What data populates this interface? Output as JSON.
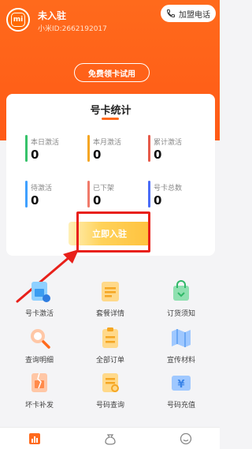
{
  "header": {
    "user_name": "未入驻",
    "user_id": "小米ID:2662192017",
    "avatar_icon": "mi-logo-icon",
    "hotline_label": "加盟电话",
    "trial_button": "免费领卡试用"
  },
  "stats_card": {
    "title": "号卡统计",
    "items": [
      {
        "label": "本日激活",
        "value": "0",
        "color": "#36c26a"
      },
      {
        "label": "本月激活",
        "value": "0",
        "color": "#f5a623"
      },
      {
        "label": "累计激活",
        "value": "0",
        "color": "#e65a4a"
      },
      {
        "label": "待激活",
        "value": "0",
        "color": "#3fa0ff"
      },
      {
        "label": "已下架",
        "value": "0",
        "color": "#f07a6a"
      },
      {
        "label": "号卡总数",
        "value": "0",
        "color": "#4a6cf7"
      }
    ],
    "cta_label": "立即入驻"
  },
  "grid": {
    "items": [
      {
        "label": "号卡激活",
        "icon": "sim-card-icon"
      },
      {
        "label": "套餐详情",
        "icon": "package-detail-icon"
      },
      {
        "label": "订货须知",
        "icon": "shopping-bag-icon"
      },
      {
        "label": "查询明细",
        "icon": "search-icon"
      },
      {
        "label": "全部订单",
        "icon": "order-list-icon"
      },
      {
        "label": "宣传材料",
        "icon": "map-icon"
      },
      {
        "label": "坏卡补发",
        "icon": "broken-card-icon"
      },
      {
        "label": "号码查询",
        "icon": "number-search-icon"
      },
      {
        "label": "号码充值",
        "icon": "recharge-icon"
      }
    ]
  },
  "tabbar": {
    "tabs": [
      {
        "icon": "home-chart-icon",
        "active": true
      },
      {
        "icon": "money-bag-icon",
        "active": false
      },
      {
        "icon": "profile-smile-icon",
        "active": false
      }
    ]
  },
  "colors": {
    "brand_orange": "#ff6a1c",
    "highlight_red": "#e8201a",
    "cta_yellow": "#ffc23e"
  }
}
